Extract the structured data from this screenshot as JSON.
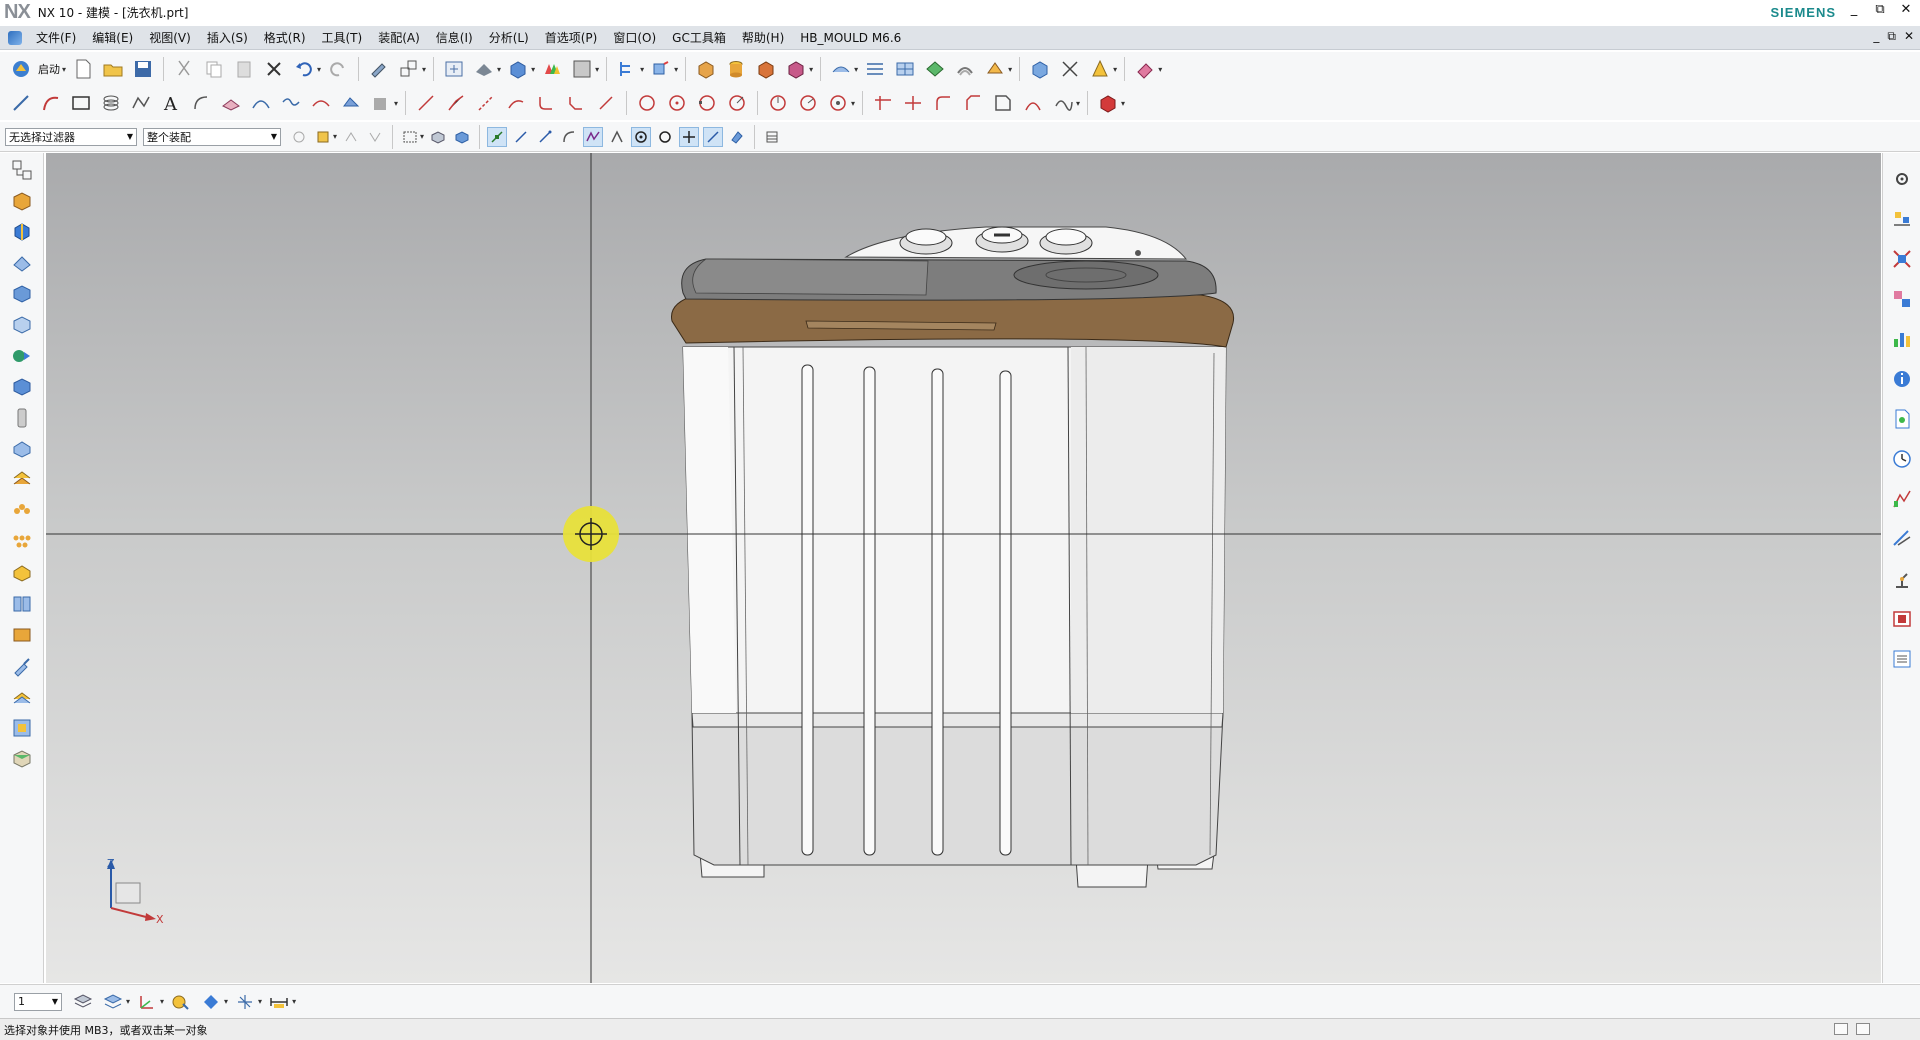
{
  "window": {
    "logo": "NX",
    "title": "NX 10 - 建模 - [洗衣机.prt]",
    "brand": "SIEMENS",
    "controls": [
      "_",
      "⧉",
      "✕"
    ]
  },
  "menubar": {
    "items": [
      "文件(F)",
      "编辑(E)",
      "视图(V)",
      "插入(S)",
      "格式(R)",
      "工具(T)",
      "装配(A)",
      "信息(I)",
      "分析(L)",
      "首选项(P)",
      "窗口(O)",
      "GC工具箱",
      "帮助(H)",
      "HB_MOULD M6.6"
    ],
    "right_controls": [
      "_",
      "⧉",
      "✕"
    ]
  },
  "toolbar": {
    "start_label": "启动"
  },
  "selection": {
    "filter": "无选择过滤器",
    "scope": "整个装配"
  },
  "bottombar": {
    "layer": "1"
  },
  "status": {
    "message": "选择对象并使用 MB3，或者双击某一对象"
  },
  "triad": {
    "z": "Z",
    "x": "X"
  },
  "colors": {
    "accent": "#1b8a8c",
    "lid": "#8b6a45",
    "body": "#f2f2f2",
    "cursor": "#e8e03a"
  }
}
